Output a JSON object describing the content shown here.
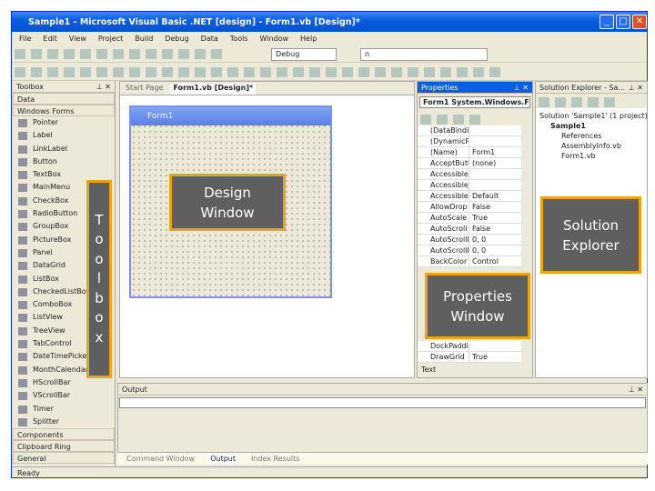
{
  "window": {
    "title": "Sample1 - Microsoft Visual Basic .NET [design] - Form1.vb [Design]*"
  },
  "menu": [
    "File",
    "Edit",
    "View",
    "Project",
    "Build",
    "Debug",
    "Data",
    "Tools",
    "Window",
    "Help"
  ],
  "toolbar": {
    "config": "Debug",
    "find": "n"
  },
  "toolbox": {
    "title": "Toolbox",
    "categories_top": [
      "Data",
      "Windows Forms"
    ],
    "items": [
      "Pointer",
      "Label",
      "LinkLabel",
      "Button",
      "TextBox",
      "MainMenu",
      "CheckBox",
      "RadioButton",
      "GroupBox",
      "PictureBox",
      "Panel",
      "DataGrid",
      "ListBox",
      "CheckedListBox",
      "ComboBox",
      "ListView",
      "TreeView",
      "TabControl",
      "DateTimePicker",
      "MonthCalendar",
      "HScrollBar",
      "VScrollBar",
      "Timer",
      "Splitter"
    ],
    "categories_bottom": [
      "Components",
      "Clipboard Ring",
      "General"
    ]
  },
  "document": {
    "tabs": [
      "Start Page",
      "Form1.vb [Design]*"
    ],
    "form_title": "Form1"
  },
  "properties": {
    "title": "Properties",
    "object": "Form1  System.Windows.F",
    "rows": [
      [
        "(DataBindings)",
        ""
      ],
      [
        "(DynamicProperties)",
        ""
      ],
      [
        "(Name)",
        "Form1"
      ],
      [
        "AcceptButton",
        "(none)"
      ],
      [
        "AccessibleDescription",
        ""
      ],
      [
        "AccessibleName",
        ""
      ],
      [
        "AccessibleRole",
        "Default"
      ],
      [
        "AllowDrop",
        "False"
      ],
      [
        "AutoScale",
        "True"
      ],
      [
        "AutoScroll",
        "False"
      ],
      [
        "AutoScrollMargin",
        "0, 0"
      ],
      [
        "AutoScrollMinSize",
        "0, 0"
      ],
      [
        "BackColor",
        "Control"
      ]
    ],
    "rows_bottom": [
      [
        "DockPadding",
        ""
      ],
      [
        "DrawGrid",
        "True"
      ]
    ],
    "description": "Text"
  },
  "solution": {
    "title": "Solution Explorer - Sa...",
    "items": [
      "Solution 'Sample1' (1 project)",
      "Sample1",
      "References",
      "AssemblyInfo.vb",
      "Form1.vb"
    ]
  },
  "output": {
    "title": "Output",
    "tabs": [
      "Command Window",
      "Output",
      "Index Results"
    ]
  },
  "status": "Ready",
  "annotations": {
    "toolbox": [
      "T",
      "o",
      "o",
      "l",
      "b",
      "o",
      "x"
    ],
    "design": "Design Window",
    "properties": "Properties Window",
    "solution": "Solution Explorer"
  },
  "colors": {
    "annotation_bg": "#5f5f5f",
    "annotation_border": "#e8a418",
    "titlebar": "#0a5fe0"
  }
}
